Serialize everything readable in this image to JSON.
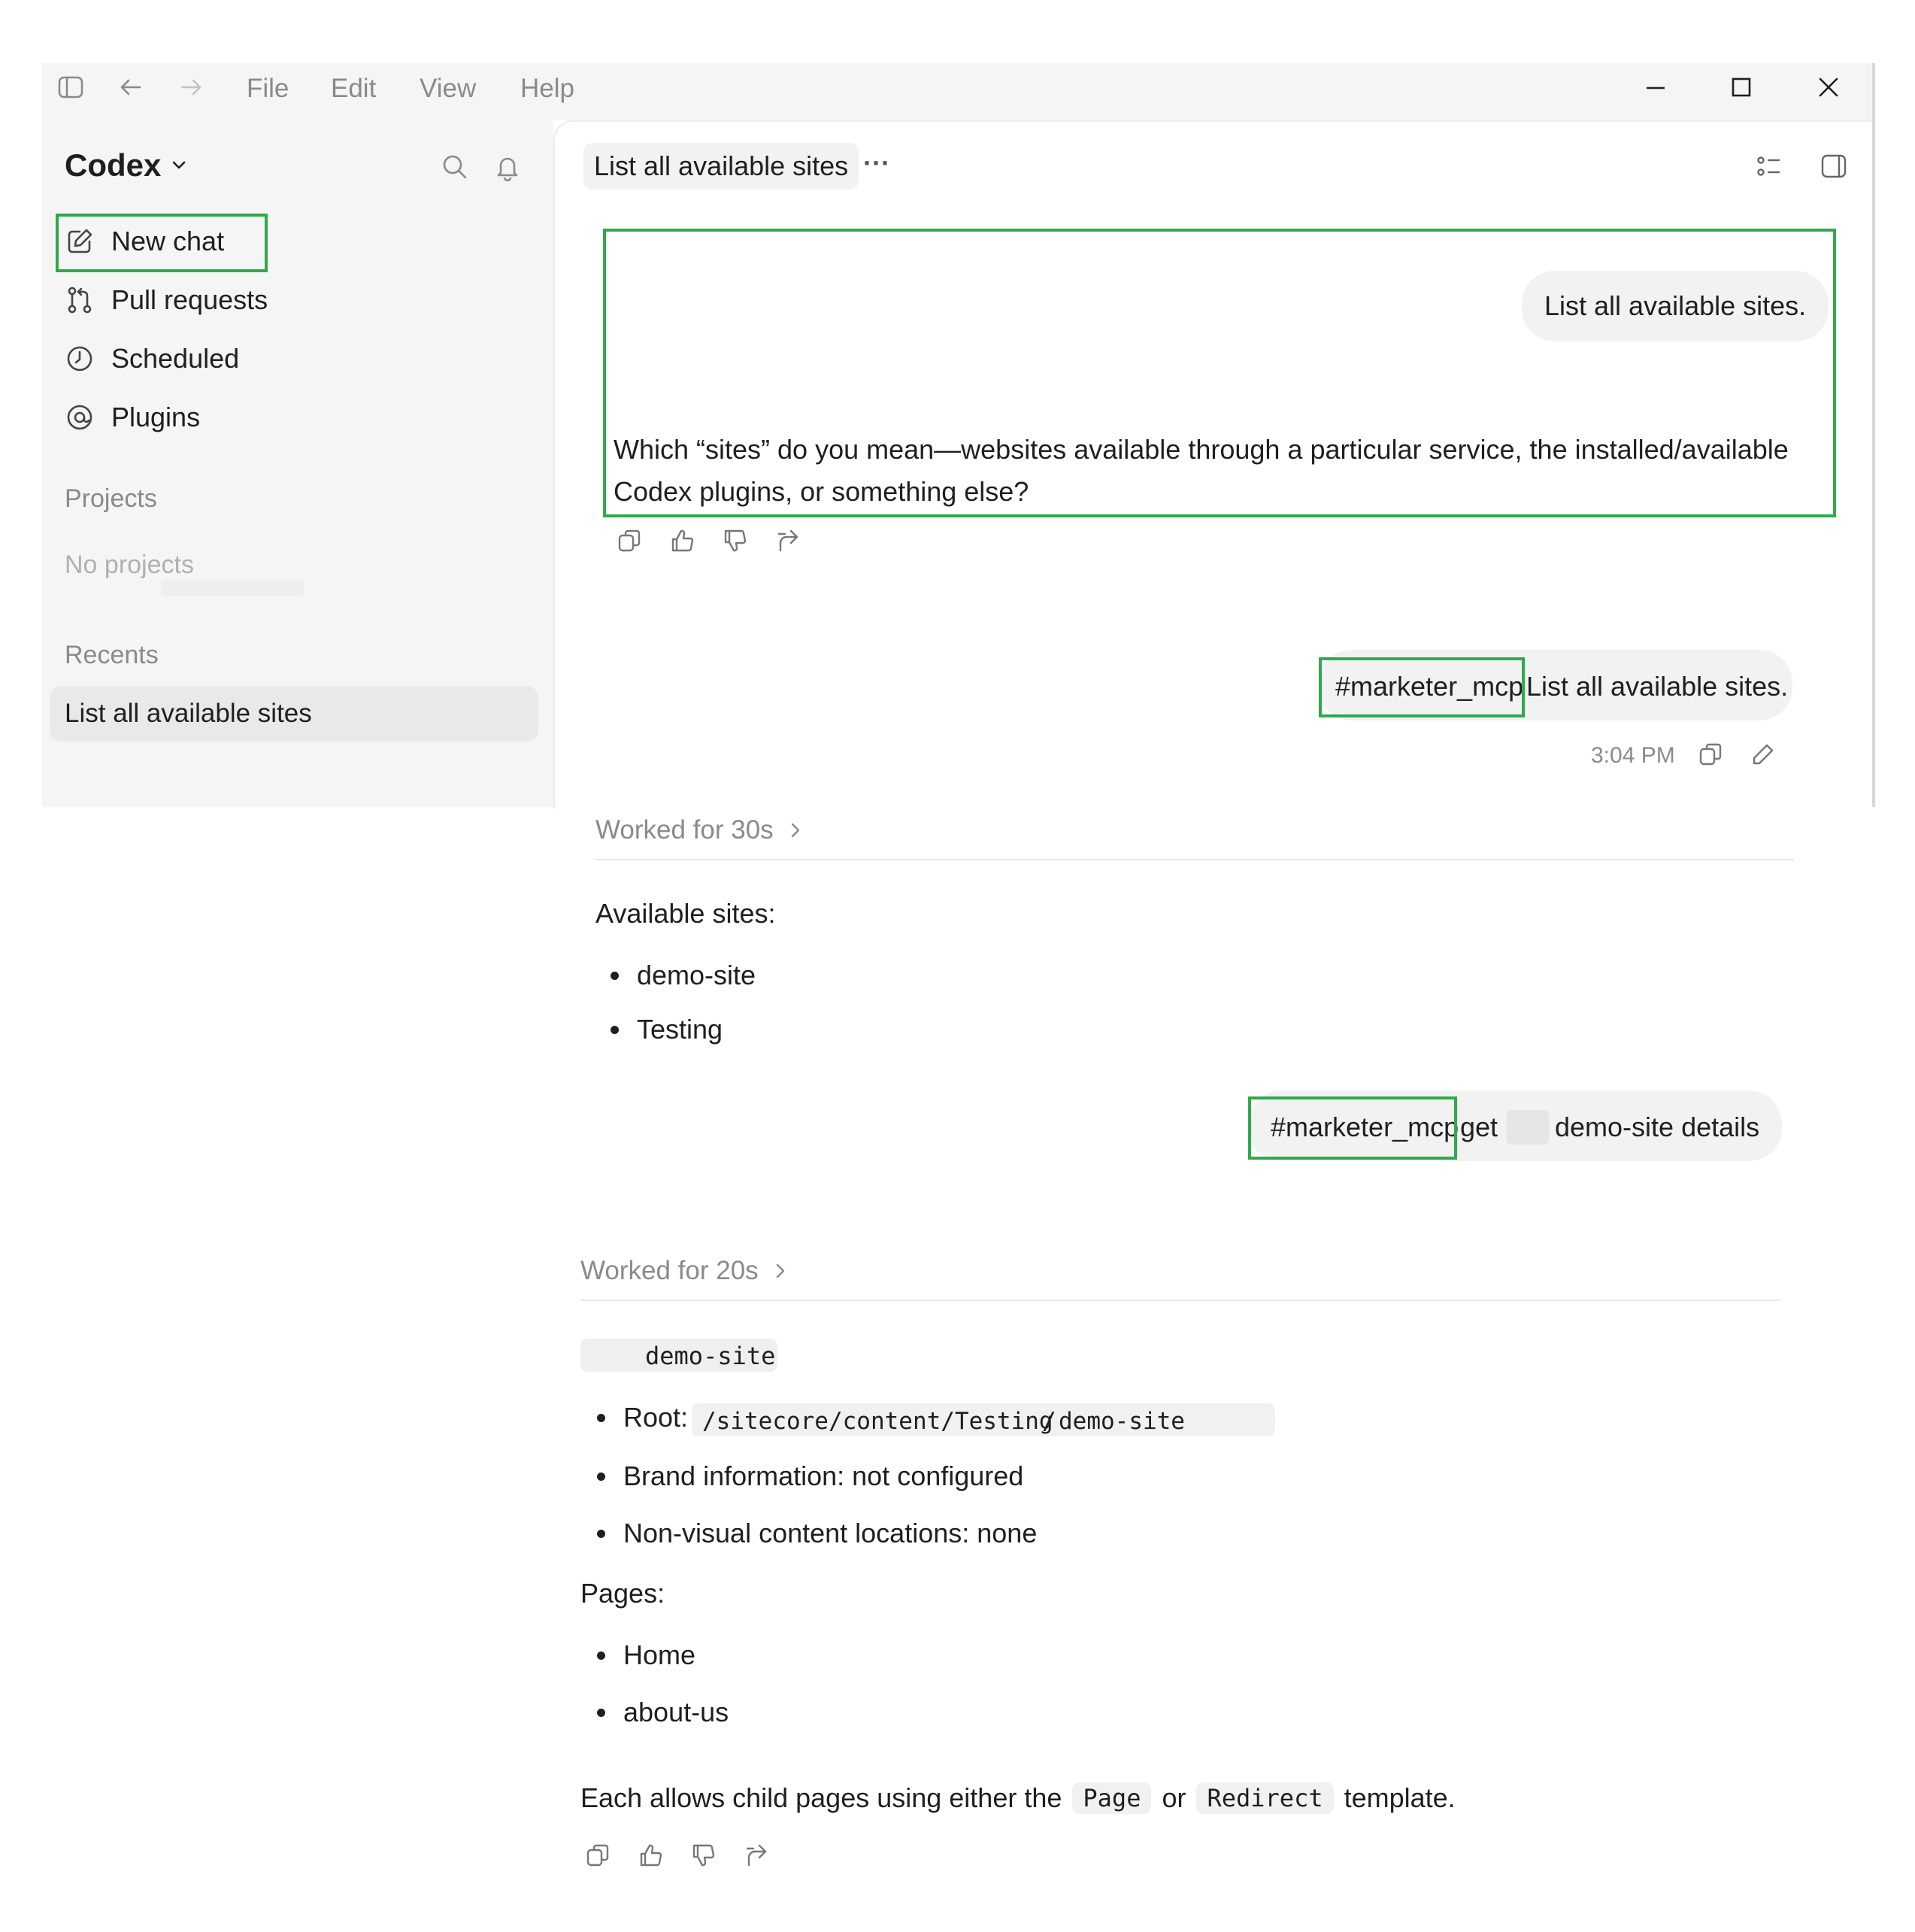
{
  "menubar": {
    "file": "File",
    "edit": "Edit",
    "view": "View",
    "help": "Help"
  },
  "sidebar": {
    "app_name": "Codex",
    "nav": [
      {
        "label": "New chat",
        "icon": "compose-icon"
      },
      {
        "label": "Pull requests",
        "icon": "pull-request-icon"
      },
      {
        "label": "Scheduled",
        "icon": "clock-icon"
      },
      {
        "label": "Plugins",
        "icon": "plugin-icon"
      }
    ],
    "projects_title": "Projects",
    "projects_empty": "No projects",
    "recents_title": "Recents",
    "recents": [
      {
        "label": "List all available sites"
      }
    ]
  },
  "header": {
    "chat_title": "List all available sites",
    "more": "···"
  },
  "conversation": {
    "msg1_user": "List all available sites.",
    "msg1_assistant": "Which “sites” do you mean—websites available through a particular service, the installed/available Codex plugins, or something else?",
    "msg2_user_tag": "#marketer_mcp",
    "msg2_user_text": "List all available sites.",
    "msg2_time": "3:04 PM",
    "msg2_worked": "Worked for 30s",
    "msg2_answer_intro": "Available sites:",
    "msg2_sites": [
      "demo-site",
      "Testing"
    ],
    "msg3_user_tag": "#marketer_mcp",
    "msg3_user_get": "get",
    "msg3_user_text": "demo-site details",
    "msg3_worked": "Worked for 20s",
    "msg3_heading_code": "demo-site",
    "msg3_root_label": "Root:",
    "msg3_root_path_a": "/sitecore/content/Testing",
    "msg3_root_path_b": "/",
    "msg3_root_path_c": "demo-site",
    "msg3_brand": "Brand information: not configured",
    "msg3_nonvisual": "Non-visual content locations: none",
    "msg3_pages_label": "Pages:",
    "msg3_pages": [
      "Home",
      "about-us"
    ],
    "msg3_footer_a": "Each allows child pages using either the",
    "msg3_footer_code1": "Page",
    "msg3_footer_or": "or",
    "msg3_footer_code2": "Redirect",
    "msg3_footer_b": "template."
  },
  "colors": {
    "highlight": "#2faa4a",
    "bubble": "#f2f2f2",
    "sidebar_bg": "#f5f5f5",
    "muted_text": "#8a8a8a"
  }
}
